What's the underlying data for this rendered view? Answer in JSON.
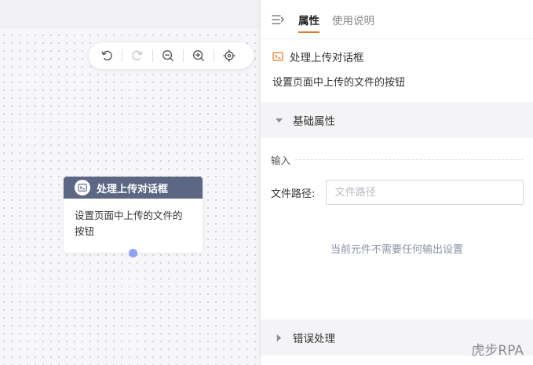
{
  "toolbar": {
    "icons": [
      "undo-icon",
      "redo-icon",
      "zoom-out-icon",
      "zoom-in-icon",
      "locate-icon"
    ]
  },
  "node": {
    "title": "处理上传对话框",
    "description": "设置页面中上传的文件的按钮",
    "header_color": "#5c6784"
  },
  "panel": {
    "tabs": [
      {
        "label": "属性",
        "active": true
      },
      {
        "label": "使用说明",
        "active": false
      }
    ],
    "component": {
      "title": "处理上传对话框",
      "description": "设置页面中上传的文件的按钮"
    },
    "basic_section": {
      "title": "基础属性",
      "input_group_label": "输入",
      "file_path_label": "文件路径:",
      "file_path_placeholder": "文件路径",
      "file_path_value": "",
      "no_output_text": "当前元件不需要任何输出设置"
    },
    "error_section": {
      "title": "错误处理"
    }
  },
  "watermark": "虎步RPA",
  "colors": {
    "accent": "#e07a2a",
    "node_header": "#5c6784",
    "port": "#8ea3f2",
    "muted_text": "#8b93a7"
  }
}
